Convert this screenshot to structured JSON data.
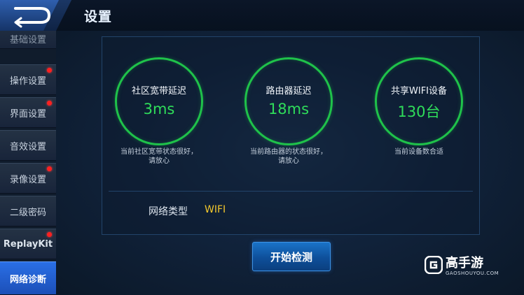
{
  "header": {
    "title": "设置"
  },
  "sidebar": {
    "items": [
      {
        "label": "基础设置",
        "badge": false
      },
      {
        "label": "操作设置",
        "badge": true
      },
      {
        "label": "界面设置",
        "badge": true
      },
      {
        "label": "音效设置",
        "badge": false
      },
      {
        "label": "录像设置",
        "badge": true
      },
      {
        "label": "二级密码",
        "badge": false
      },
      {
        "label": "ReplayKit",
        "badge": true
      },
      {
        "label": "网络诊断",
        "badge": false,
        "active": true
      }
    ]
  },
  "stats": [
    {
      "label": "社区宽带延迟",
      "value": "3ms",
      "desc_line1": "当前社区宽带状态很好，",
      "desc_line2": "请放心"
    },
    {
      "label": "路由器延迟",
      "value": "18ms",
      "desc_line1": "当前路由器的状态很好，",
      "desc_line2": "请放心"
    },
    {
      "label": "共享WIFI设备",
      "value": "130台",
      "desc_line1": "当前设备数合适",
      "desc_line2": ""
    }
  ],
  "network": {
    "label": "网络类型",
    "value": "WIFI"
  },
  "start_button": {
    "label": "开始检测"
  },
  "watermark": {
    "text": "高手游",
    "sub": "GAOSHOUYOU.COM"
  },
  "colors": {
    "accent_green": "#2fdc5a",
    "wifi_yellow": "#f2c72c",
    "active_blue": "#2a6fe6",
    "badge_red": "#ff2020"
  }
}
